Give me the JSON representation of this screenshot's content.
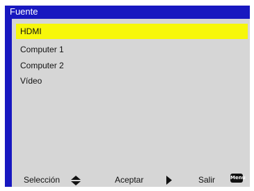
{
  "window": {
    "title": "Fuente"
  },
  "menu": {
    "items": [
      {
        "label": "HDMI",
        "selected": true
      },
      {
        "label": "Computer 1",
        "selected": false
      },
      {
        "label": "Computer 2",
        "selected": false
      },
      {
        "label": "Vídeo",
        "selected": false
      }
    ]
  },
  "footer": {
    "select_label": "Selección",
    "accept_label": "Aceptar",
    "exit_label": "Salir",
    "menu_key_label": "Menu"
  },
  "colors": {
    "frame": "#1818c0",
    "panel": "#d6d6d6",
    "highlight": "#f7f70a"
  },
  "icons": {
    "select": "up-down-arrows-icon",
    "accept": "right-arrow-icon",
    "exit": "menu-key-icon"
  }
}
